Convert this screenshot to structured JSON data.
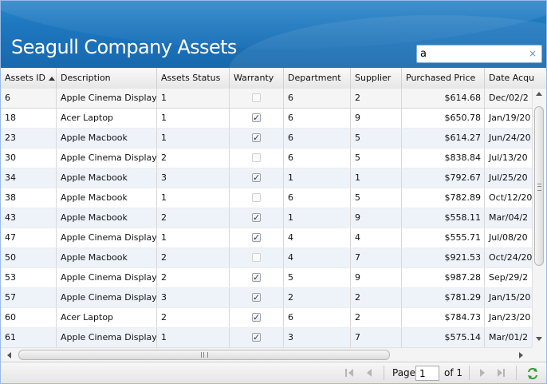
{
  "header": {
    "title": "Seagull Company Assets",
    "search_value": "a",
    "search_clear": "×"
  },
  "columns": [
    {
      "label": "Assets ID",
      "sorted": "asc"
    },
    {
      "label": "Description"
    },
    {
      "label": "Assets Status"
    },
    {
      "label": "Warranty"
    },
    {
      "label": "Department"
    },
    {
      "label": "Supplier"
    },
    {
      "label": "Purchased Price"
    },
    {
      "label": "Date Acqu"
    }
  ],
  "rows": [
    {
      "id": "6",
      "description": "Apple Cinema Display",
      "status": "1",
      "warranty": false,
      "department": "6",
      "supplier": "2",
      "price": "$614.68",
      "date": "Dec/02/2"
    },
    {
      "id": "18",
      "description": "Acer Laptop",
      "status": "1",
      "warranty": true,
      "department": "6",
      "supplier": "9",
      "price": "$650.78",
      "date": "Jan/19/20"
    },
    {
      "id": "23",
      "description": "Apple Macbook",
      "status": "1",
      "warranty": true,
      "department": "6",
      "supplier": "5",
      "price": "$614.27",
      "date": "Jun/24/20"
    },
    {
      "id": "30",
      "description": "Apple Cinema Display",
      "status": "2",
      "warranty": false,
      "department": "6",
      "supplier": "5",
      "price": "$838.84",
      "date": "Jul/13/20"
    },
    {
      "id": "34",
      "description": "Apple Macbook",
      "status": "3",
      "warranty": true,
      "department": "1",
      "supplier": "1",
      "price": "$792.67",
      "date": "Jul/25/20"
    },
    {
      "id": "38",
      "description": "Apple Macbook",
      "status": "1",
      "warranty": false,
      "department": "6",
      "supplier": "5",
      "price": "$782.89",
      "date": "Oct/12/20"
    },
    {
      "id": "43",
      "description": "Apple Macbook",
      "status": "2",
      "warranty": true,
      "department": "1",
      "supplier": "9",
      "price": "$558.11",
      "date": "Mar/04/2"
    },
    {
      "id": "47",
      "description": "Apple Cinema Display",
      "status": "1",
      "warranty": true,
      "department": "4",
      "supplier": "4",
      "price": "$555.71",
      "date": "Jul/08/20"
    },
    {
      "id": "50",
      "description": "Apple Macbook",
      "status": "2",
      "warranty": false,
      "department": "4",
      "supplier": "7",
      "price": "$921.53",
      "date": "Oct/24/20"
    },
    {
      "id": "53",
      "description": "Apple Cinema Display",
      "status": "2",
      "warranty": true,
      "department": "5",
      "supplier": "9",
      "price": "$987.28",
      "date": "Sep/29/2"
    },
    {
      "id": "57",
      "description": "Apple Cinema Display",
      "status": "3",
      "warranty": true,
      "department": "2",
      "supplier": "2",
      "price": "$781.29",
      "date": "Jan/15/20"
    },
    {
      "id": "60",
      "description": "Acer Laptop",
      "status": "2",
      "warranty": true,
      "department": "6",
      "supplier": "2",
      "price": "$784.73",
      "date": "Jan/23/20"
    },
    {
      "id": "61",
      "description": "Apple Cinema Display",
      "status": "1",
      "warranty": true,
      "department": "3",
      "supplier": "7",
      "price": "$575.14",
      "date": "Mar/01/2"
    }
  ],
  "pager": {
    "page_label": "Page",
    "page_value": "1",
    "of_label": "of 1"
  },
  "icons": {
    "checkmark": "✓",
    "refresh": "refresh-icon"
  },
  "colors": {
    "header_blue": "#1e78bf",
    "row_alt": "#eef3fa",
    "refresh_green": "#3a9a3a"
  }
}
